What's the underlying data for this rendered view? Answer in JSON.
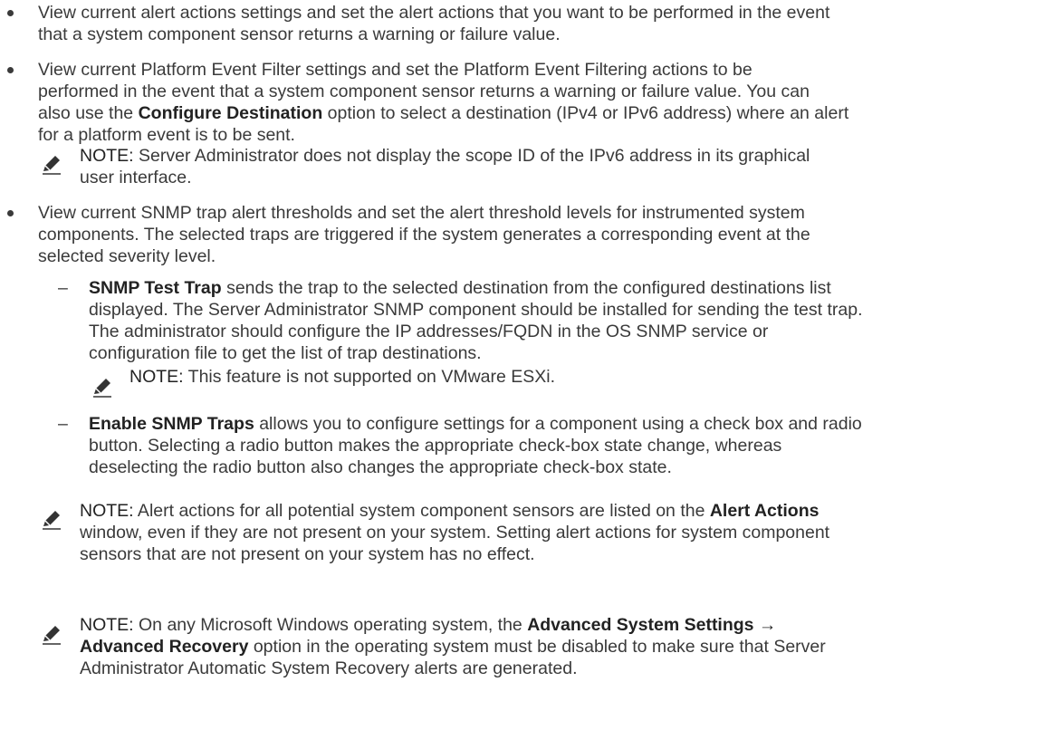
{
  "bullets": [
    {
      "lines": [
        "View current alert actions settings and set the alert actions that you want to be performed in the event",
        "that a system component sensor returns a warning or failure value."
      ]
    },
    {
      "lines": [
        "View current Platform Event Filter settings and set the Platform Event Filtering actions to be",
        "performed in the event that a system component sensor returns a warning or failure value. You can"
      ],
      "line3_prefix": "also use the ",
      "line3_bold": "Configure Destination",
      "line3_suffix": " option to select a destination (IPv4 or IPv6 address) where an alert",
      "line4": "for a platform event is to be sent."
    },
    {
      "lines": [
        "View current SNMP trap alert thresholds and set the alert threshold levels for instrumented system",
        "components. The selected traps are triggered if the system generates a corresponding event at the",
        "selected severity level."
      ]
    }
  ],
  "note1": {
    "label": "NOTE:",
    "line1": " Server Administrator does not display the scope ID of the IPv6 address in its graphical",
    "line2": "user interface."
  },
  "sub1": {
    "bold": "SNMP Test Trap",
    "line1_rest": " sends the trap to the selected destination from the configured destinations list",
    "lines": [
      "displayed. The Server Administrator SNMP component should be installed for sending the test trap.",
      "The administrator should configure the IP addresses/FQDN in the OS SNMP service or",
      "configuration file to get the list of trap destinations."
    ]
  },
  "note2": {
    "label": "NOTE:",
    "text": " This feature is not supported on VMware ESXi."
  },
  "sub2": {
    "bold": "Enable SNMP Traps",
    "line1_rest": " allows you to configure settings for a component using a check box and radio",
    "lines": [
      "button. Selecting a radio button makes the appropriate check-box state change, whereas",
      "deselecting the radio button also changes the appropriate check-box state."
    ]
  },
  "note3": {
    "label": "NOTE:",
    "line1_a": " Alert actions for all potential system component sensors are listed on the ",
    "line1_bold": "Alert Actions",
    "line2": "window, even if they are not present on your system. Setting alert actions for system component",
    "line3": "sensors that are not present on your system has no effect."
  },
  "note4": {
    "label": "NOTE:",
    "line1_a": " On any Microsoft Windows operating system, the ",
    "line1_bold": "Advanced System Settings →",
    "line2_bold": "Advanced Recovery",
    "line2_rest": " option in the operating system must be disabled to make sure that Server",
    "line3": "Administrator Automatic System Recovery alerts are generated."
  },
  "colors": {
    "text": "#3a3a3a",
    "icon": "#333333"
  },
  "icons": {
    "note": "pencil-icon"
  },
  "sub_marker": "–"
}
